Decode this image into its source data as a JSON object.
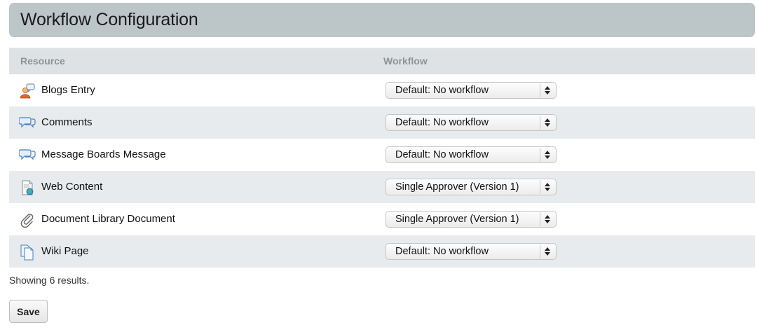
{
  "header": {
    "title": "Workflow Configuration"
  },
  "table": {
    "columns": {
      "resource": "Resource",
      "workflow": "Workflow"
    },
    "rows": [
      {
        "resource": "Blogs Entry",
        "icon": "blogs-entry-icon",
        "workflow": "Default: No workflow"
      },
      {
        "resource": "Comments",
        "icon": "comments-icon",
        "workflow": "Default: No workflow"
      },
      {
        "resource": "Message Boards Message",
        "icon": "message-boards-icon",
        "workflow": "Default: No workflow"
      },
      {
        "resource": "Web Content",
        "icon": "web-content-icon",
        "workflow": "Single Approver (Version 1)"
      },
      {
        "resource": "Document Library Document",
        "icon": "paperclip-icon",
        "workflow": "Single Approver (Version 1)"
      },
      {
        "resource": "Wiki Page",
        "icon": "wiki-page-icon",
        "workflow": "Default: No workflow"
      }
    ]
  },
  "footer": {
    "results_text": "Showing 6 results.",
    "save_label": "Save"
  },
  "colors": {
    "header_bg": "#bcc6c9",
    "table_head_bg": "#dfe2e4",
    "row_alt_bg": "#e8ebed"
  }
}
